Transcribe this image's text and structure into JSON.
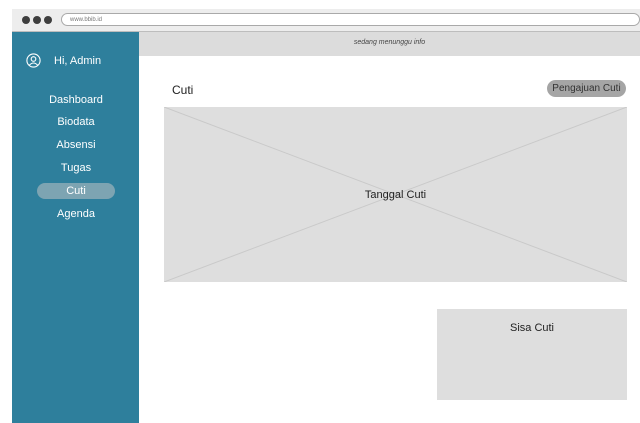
{
  "browser": {
    "url": "www.bbib.id"
  },
  "sidebar": {
    "greeting": "Hi, Admin",
    "items": [
      {
        "label": "Dashboard",
        "active": false
      },
      {
        "label": "Biodata",
        "active": false
      },
      {
        "label": "Absensi",
        "active": false
      },
      {
        "label": "Tugas",
        "active": false
      },
      {
        "label": "Cuti",
        "active": true
      },
      {
        "label": "Agenda",
        "active": false
      }
    ]
  },
  "header": {
    "status": "sedang menunggu info"
  },
  "main": {
    "title": "Cuti",
    "submit_label": "Pengajuan Cuti",
    "leave_dates_label": "Tanggal Cuti",
    "leave_balance_label": "Sisa Cuti"
  },
  "colors": {
    "sidebar": "#2e7f9c",
    "active_item": "#7da4b2",
    "placeholder": "#dedede",
    "button": "#a5a5a5"
  },
  "icons": {
    "avatar": "user-circle-icon"
  }
}
